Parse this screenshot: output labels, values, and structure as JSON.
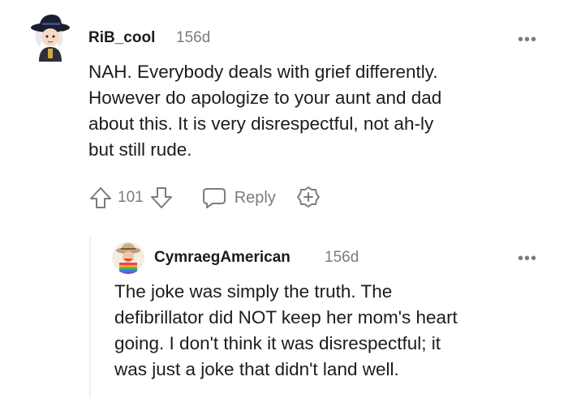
{
  "comment": {
    "username": "RiB_cool",
    "age": "156d",
    "menu_glyph": "•••",
    "text_lines": [
      "NAH. Everybody deals with grief differently.",
      "However do apologize to your aunt and dad",
      "about this. It is very disrespectful, not ah-ly",
      "but still rude."
    ],
    "upvote_icon": "arrow-up-outline-icon",
    "downvote_icon": "arrow-down-outline-icon",
    "score": "101",
    "reply_label": "Reply",
    "reply_icon": "speech-bubble-icon",
    "award_icon": "add-award-icon"
  },
  "reply": {
    "username": "CymraegAmerican",
    "age": "156d",
    "menu_glyph": "•••",
    "text_lines": [
      "The joke was simply the truth. The",
      "defibrillator did NOT keep her mom's heart",
      "going. I don't think it was disrespectful; it",
      "was just a joke that didn't land well."
    ]
  },
  "colors": {
    "text": "#1c1c1c",
    "meta": "#7c7c7c",
    "thread_line": "#edeff1"
  }
}
